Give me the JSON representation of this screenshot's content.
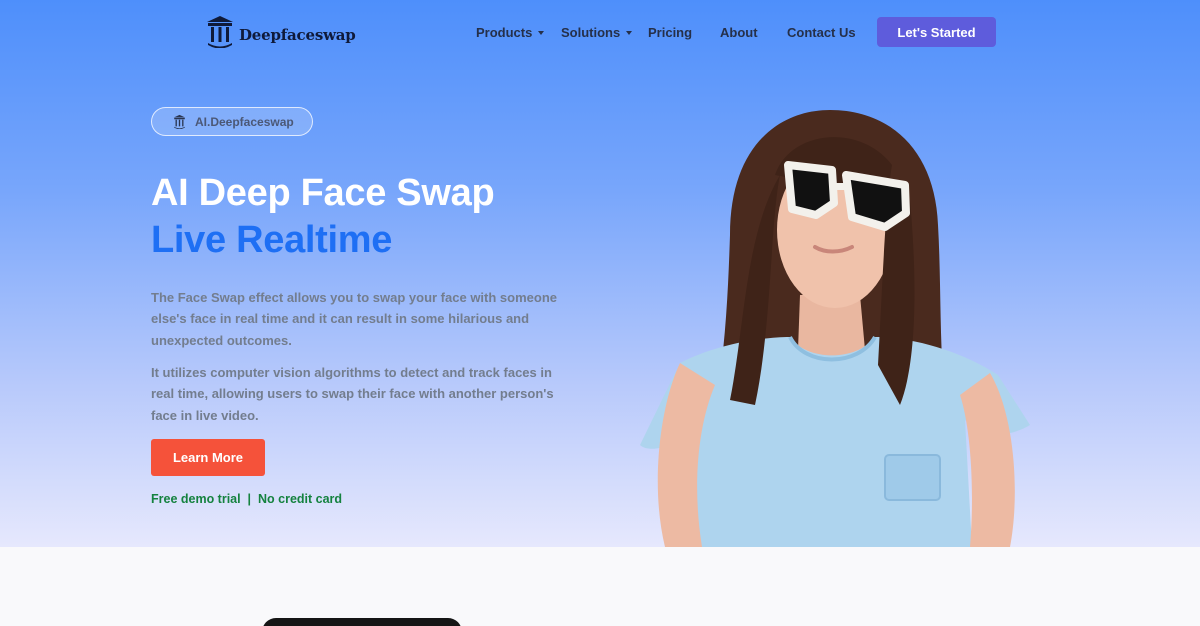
{
  "brand": {
    "name": "Deepfaceswap"
  },
  "nav": {
    "items": [
      {
        "label": "Products",
        "has_dropdown": true
      },
      {
        "label": "Solutions",
        "has_dropdown": true
      },
      {
        "label": "Pricing",
        "has_dropdown": false
      },
      {
        "label": "About",
        "has_dropdown": false
      },
      {
        "label": "Contact Us",
        "has_dropdown": false
      }
    ],
    "cta_label": "Let's Started"
  },
  "hero": {
    "badge": "AI.Deepfaceswap",
    "title_line1": "AI Deep Face Swap",
    "title_line2": "Live Realtime",
    "paragraph1": "The Face Swap effect allows you to swap your face with someone else's face in real time and it can result in some hilarious and unexpected outcomes.",
    "paragraph2": "It utilizes computer vision algorithms to detect and track faces in real time, allowing users to swap their face with another person's face in live video.",
    "button_label": "Learn More",
    "trial_note": "Free demo trial  |  No credit card"
  },
  "colors": {
    "accent": "#5e5cdc",
    "title_blue": "#1e6ff4",
    "button_orange": "#f5523a",
    "trial_green": "#15823f"
  }
}
